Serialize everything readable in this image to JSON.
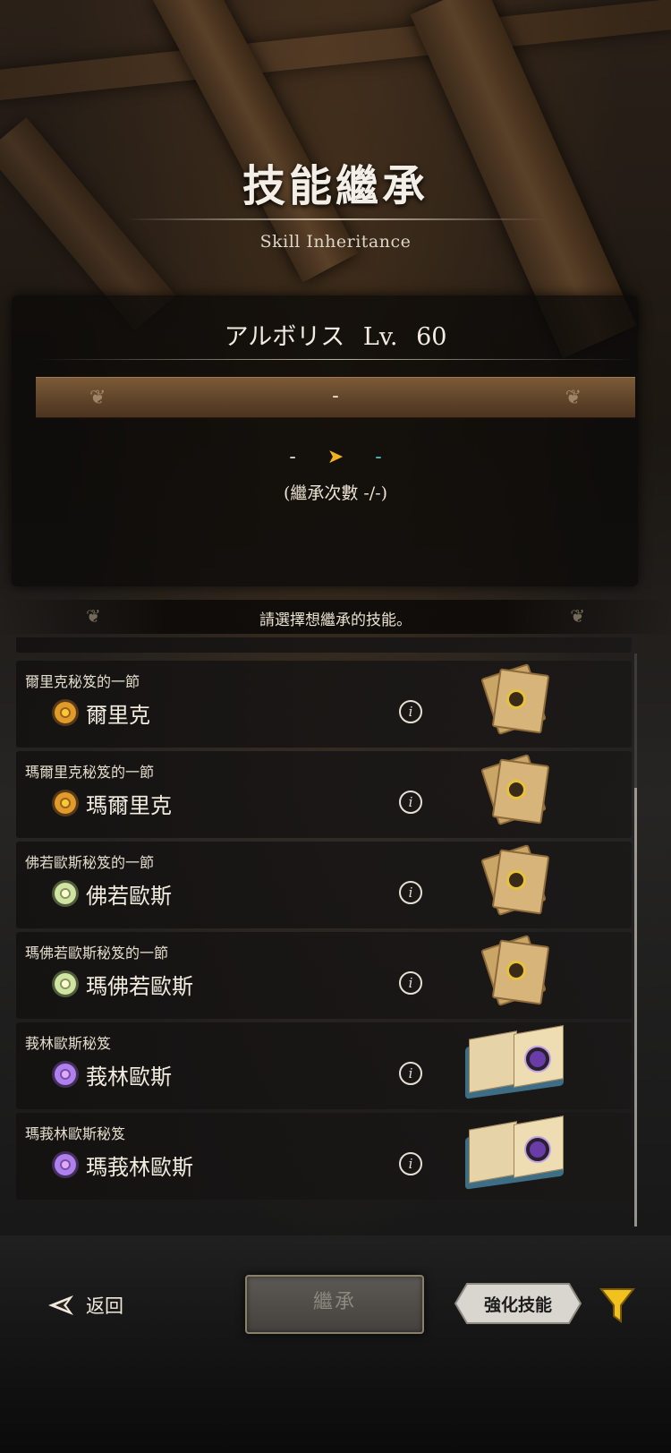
{
  "header": {
    "title": "技能繼承",
    "subtitle": "Skill Inheritance"
  },
  "character": {
    "name": "アルボリス",
    "level_label": "Lv.",
    "level": "60"
  },
  "selected_skill": {
    "value": "-"
  },
  "transfer": {
    "from": "-",
    "to": "-",
    "count_text": "(繼承次數 -/-)"
  },
  "hint": "請選擇想繼承的技能。",
  "skills": [
    {
      "name": "爾里克秘笈的一節",
      "skill": "爾里克",
      "color": "#e29a2a",
      "book": "page"
    },
    {
      "name": "瑪爾里克秘笈的一節",
      "skill": "瑪爾里克",
      "color": "#e29a2a",
      "book": "page"
    },
    {
      "name": "佛若歐斯秘笈的一節",
      "skill": "佛若歐斯",
      "color": "#cfe5a0",
      "book": "page"
    },
    {
      "name": "瑪佛若歐斯秘笈的一節",
      "skill": "瑪佛若歐斯",
      "color": "#cfe5a0",
      "book": "page"
    },
    {
      "name": "莪林歐斯秘笈",
      "skill": "莪林歐斯",
      "color": "#b080f0",
      "book": "open"
    },
    {
      "name": "瑪莪林歐斯秘笈",
      "skill": "瑪莪林歐斯",
      "color": "#b080f0",
      "book": "open"
    }
  ],
  "footer": {
    "back_label": "返回",
    "inherit_label": "繼承",
    "enhance_label": "強化技能"
  },
  "icons": {
    "info": "info-icon",
    "back": "back-arrow-icon",
    "filter": "filter-icon"
  },
  "colors": {
    "accent_arrow": "#f3b21e",
    "target_teal": "#4fc8c0",
    "filter_yellow": "#f1c21e"
  }
}
